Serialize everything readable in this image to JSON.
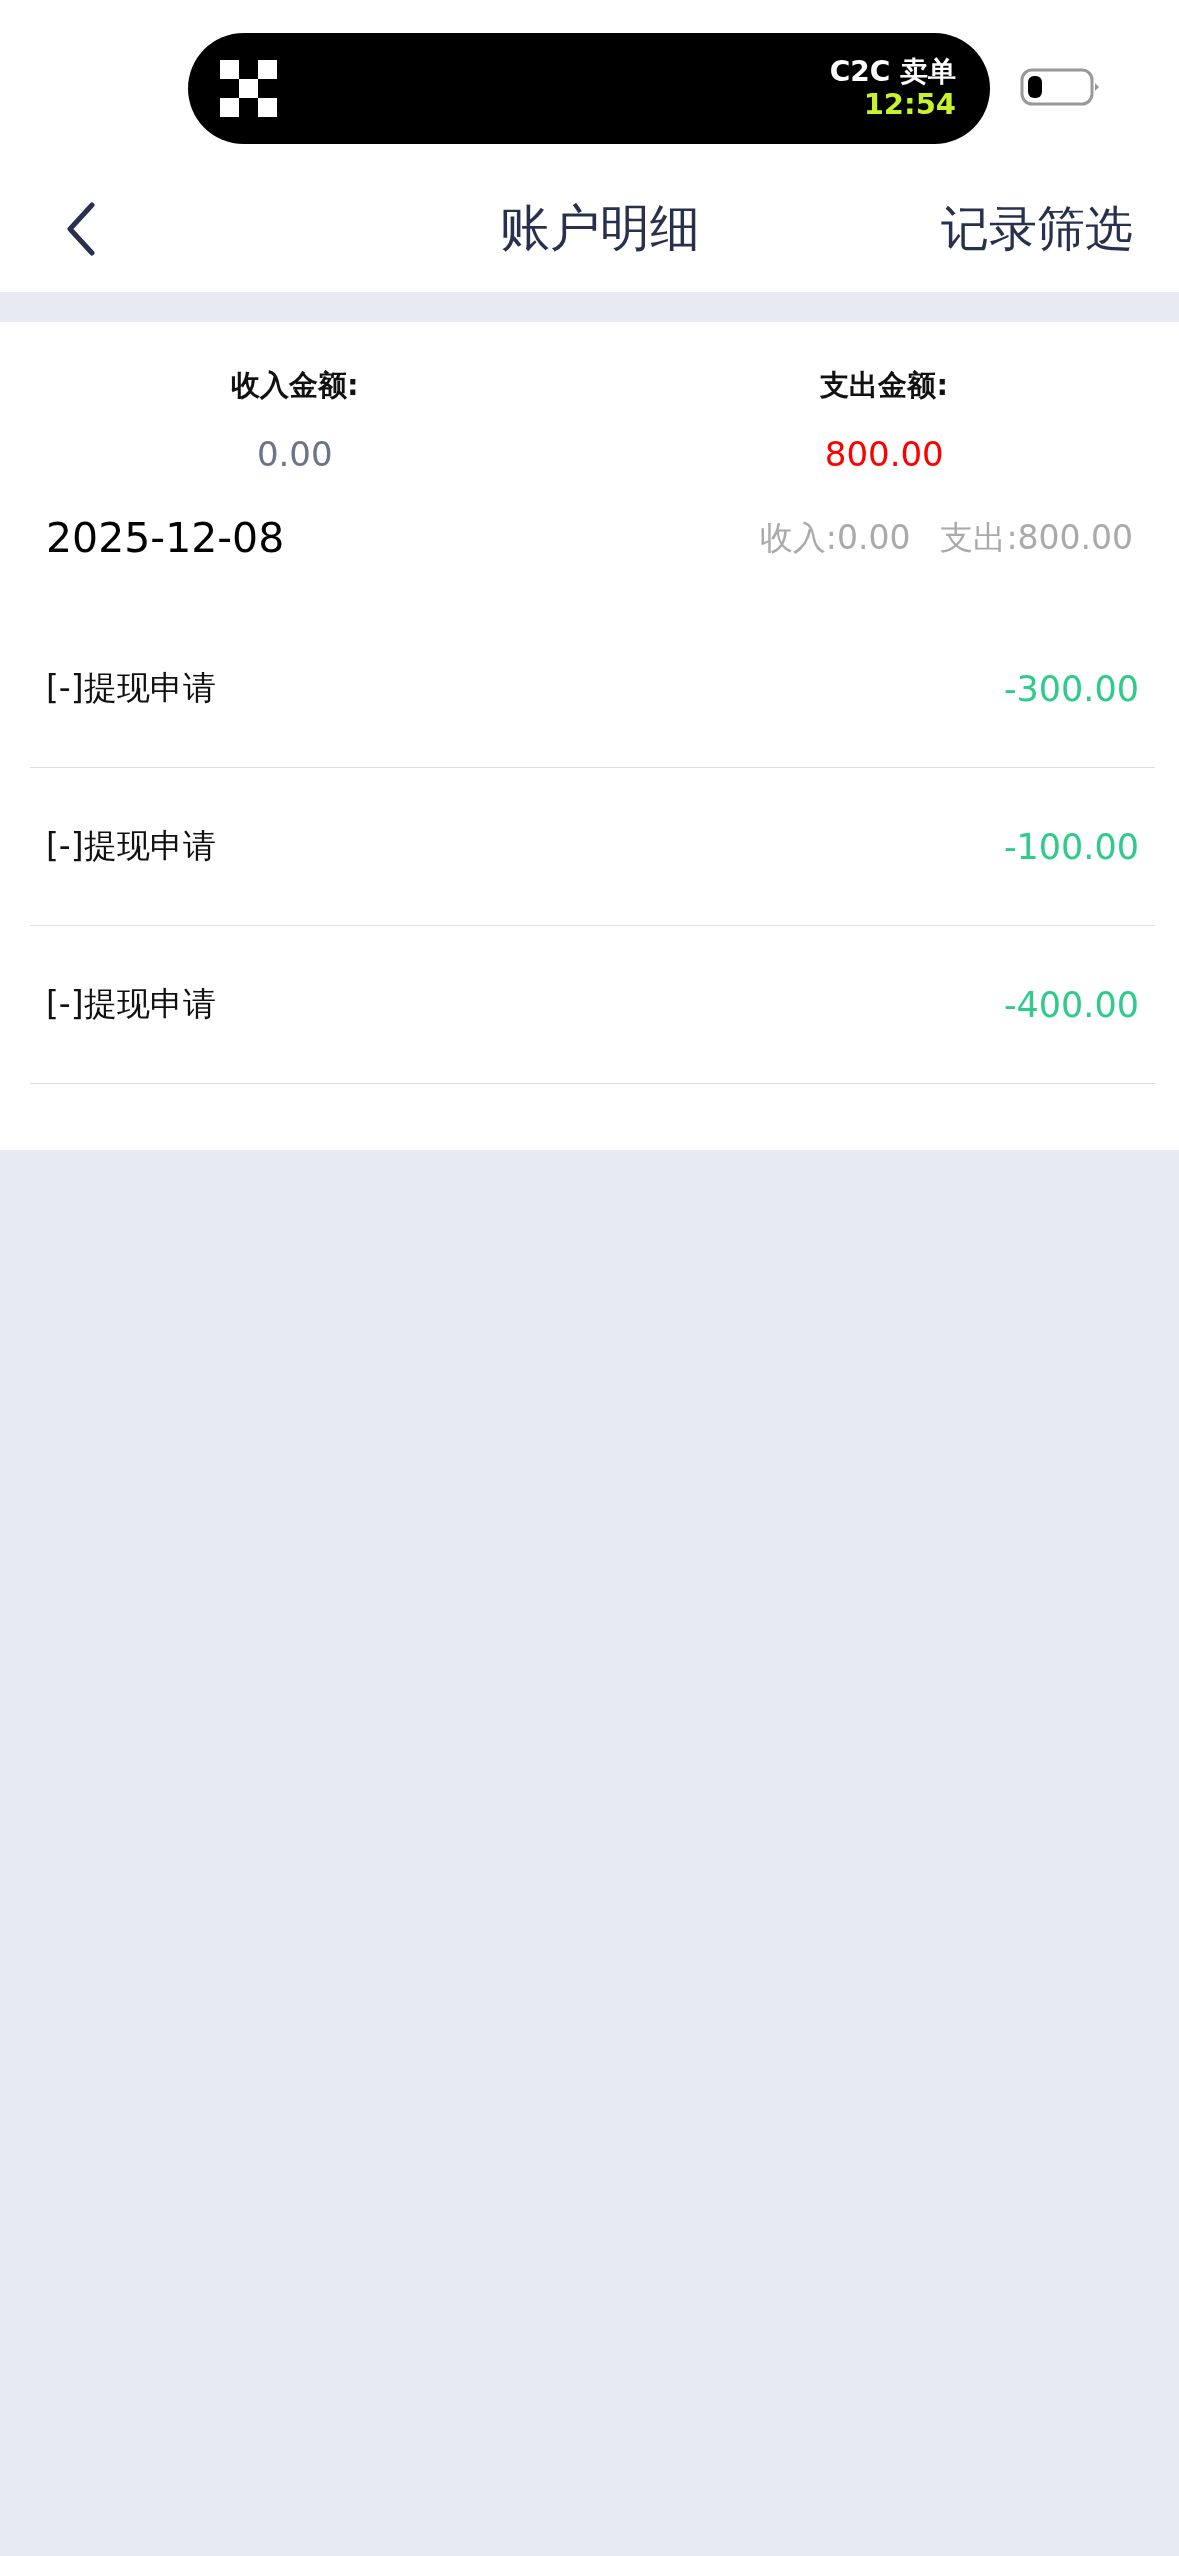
{
  "status_bar": {
    "activity_title": "C2C 卖单",
    "activity_time": "12:54"
  },
  "nav": {
    "title": "账户明细",
    "action": "记录筛选"
  },
  "summary": [
    {
      "label": "收入金额:",
      "value": "0.00",
      "kind": "income"
    },
    {
      "label": "支出金额:",
      "value": "800.00",
      "kind": "expense"
    }
  ],
  "day": {
    "date": "2025-12-08",
    "income": "收入:0.00",
    "expense": "支出:800.00"
  },
  "records": [
    {
      "title": "[-]提现申请",
      "amount": "-300.00"
    },
    {
      "title": "[-]提现申请",
      "amount": "-100.00"
    },
    {
      "title": "[-]提现申请",
      "amount": "-400.00"
    }
  ]
}
